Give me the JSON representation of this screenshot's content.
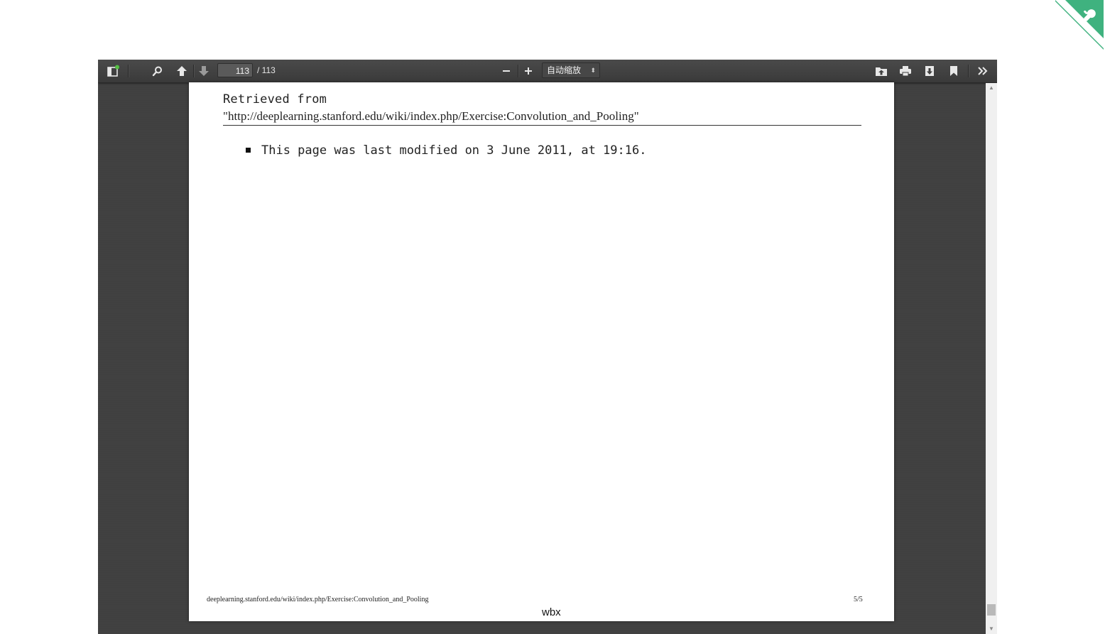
{
  "toolbar": {
    "current_page": "113",
    "page_count": "/ 113",
    "zoom_label": "自动缩放",
    "zoom_minus": "−",
    "zoom_plus": "+"
  },
  "document": {
    "retrieved_label": "Retrieved from",
    "retrieved_url": "\"http://deeplearning.stanford.edu/wiki/index.php/Exercise:Convolution_and_Pooling\"",
    "modified_text": "This page was last modified on 3 June 2011, at 19:16.",
    "footer_url": "deeplearning.stanford.edu/wiki/index.php/Exercise:Convolution_and_Pooling",
    "footer_page": "5/5",
    "watermark": "wbx"
  },
  "colors": {
    "viewer_background": "#404040",
    "toolbar_background": "#474747",
    "notification_dot": "#55c043",
    "ribbon": "#3fb27f"
  },
  "icons": {
    "sidebar_toggle": "sidebar-toggle-icon",
    "search": "search-icon",
    "previous_page": "arrow-up-icon",
    "next_page": "arrow-down-icon",
    "open_file": "open-file-icon",
    "print": "print-icon",
    "download": "download-icon",
    "bookmark": "bookmark-icon",
    "tools": "double-chevron-right-icon",
    "corner": "github-octocat-icon"
  }
}
